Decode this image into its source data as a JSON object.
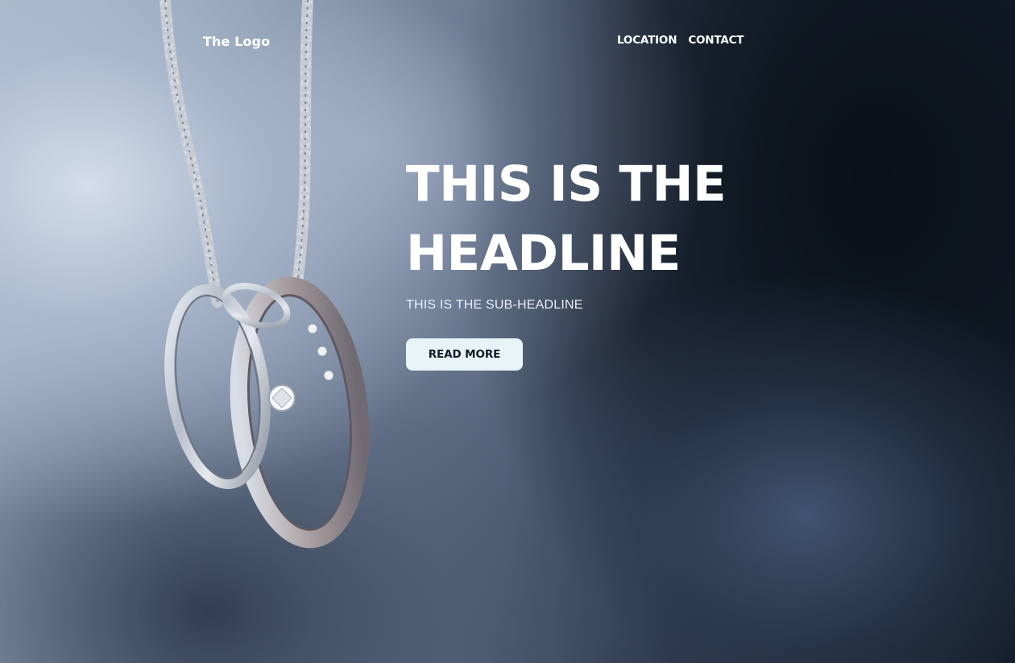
{
  "header": {
    "logo_text": "The Logo",
    "nav": [
      {
        "label": "LOCATION"
      },
      {
        "label": "CONTACT"
      }
    ]
  },
  "hero": {
    "headline": "THIS IS THE HEADLINE",
    "subheadline": "THIS IS THE SUB-HEADLINE",
    "cta_label": "READ MORE",
    "image_description_icon": "rings-on-chain-photo"
  },
  "colors": {
    "text": "#ffffff",
    "button_bg": "#e8f3f8",
    "button_text": "#121a24"
  }
}
